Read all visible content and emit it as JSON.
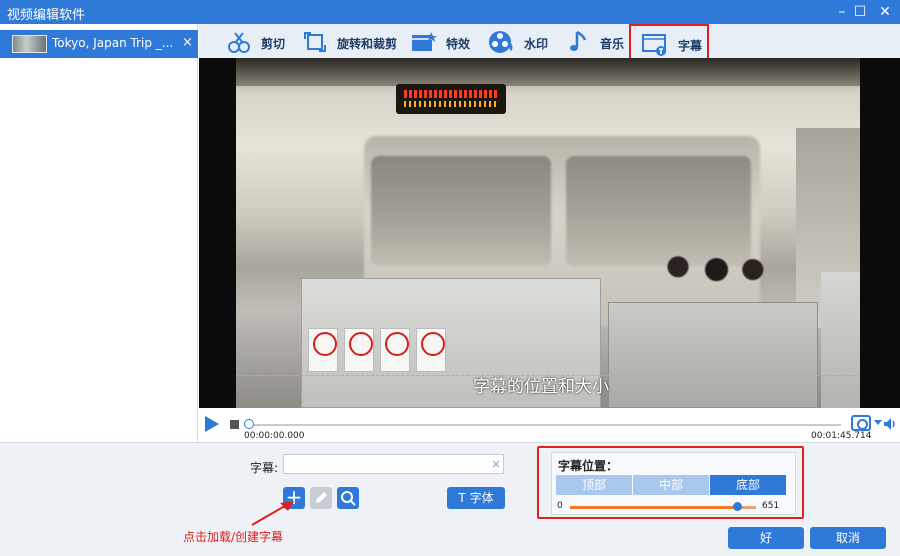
{
  "window": {
    "title": "视频编辑软件",
    "minimize_icon": "minimize-icon",
    "maximize_icon": "maximize-icon",
    "close_icon": "close-icon"
  },
  "media_list": {
    "items": [
      {
        "name": "Tokyo, Japan Trip _...",
        "close": "×"
      }
    ]
  },
  "toolbar": {
    "tools": [
      {
        "label": "剪切",
        "icon": "cut-icon"
      },
      {
        "label": "旋转和裁剪",
        "icon": "rotate-crop-icon"
      },
      {
        "label": "特效",
        "icon": "effects-icon"
      },
      {
        "label": "水印",
        "icon": "watermark-icon"
      },
      {
        "label": "音乐",
        "icon": "music-icon"
      },
      {
        "label": "字幕",
        "icon": "subtitle-icon",
        "active": true
      }
    ]
  },
  "preview": {
    "subtitle_text": "字幕的位置和大小"
  },
  "player": {
    "time_current": "00:00:00.000",
    "time_total": "00:01:45.714",
    "progress": 0
  },
  "subtitle_panel": {
    "label": "字幕:",
    "input_value": "",
    "clear": "×",
    "add": "+",
    "font_button": "字体",
    "font_icon": "T",
    "hint": "点击加载/创建字幕"
  },
  "position_panel": {
    "title": "字幕位置：",
    "options": [
      "顶部",
      "中部",
      "底部"
    ],
    "selected": "底部",
    "slider_min": "0",
    "slider_max": "651",
    "slider_fraction": 0.9
  },
  "footer": {
    "ok": "好",
    "cancel": "取消"
  },
  "colors": {
    "accent": "#2f7ad9",
    "highlight": "#e0201f",
    "toolbar_bg": "#e8eef6"
  }
}
